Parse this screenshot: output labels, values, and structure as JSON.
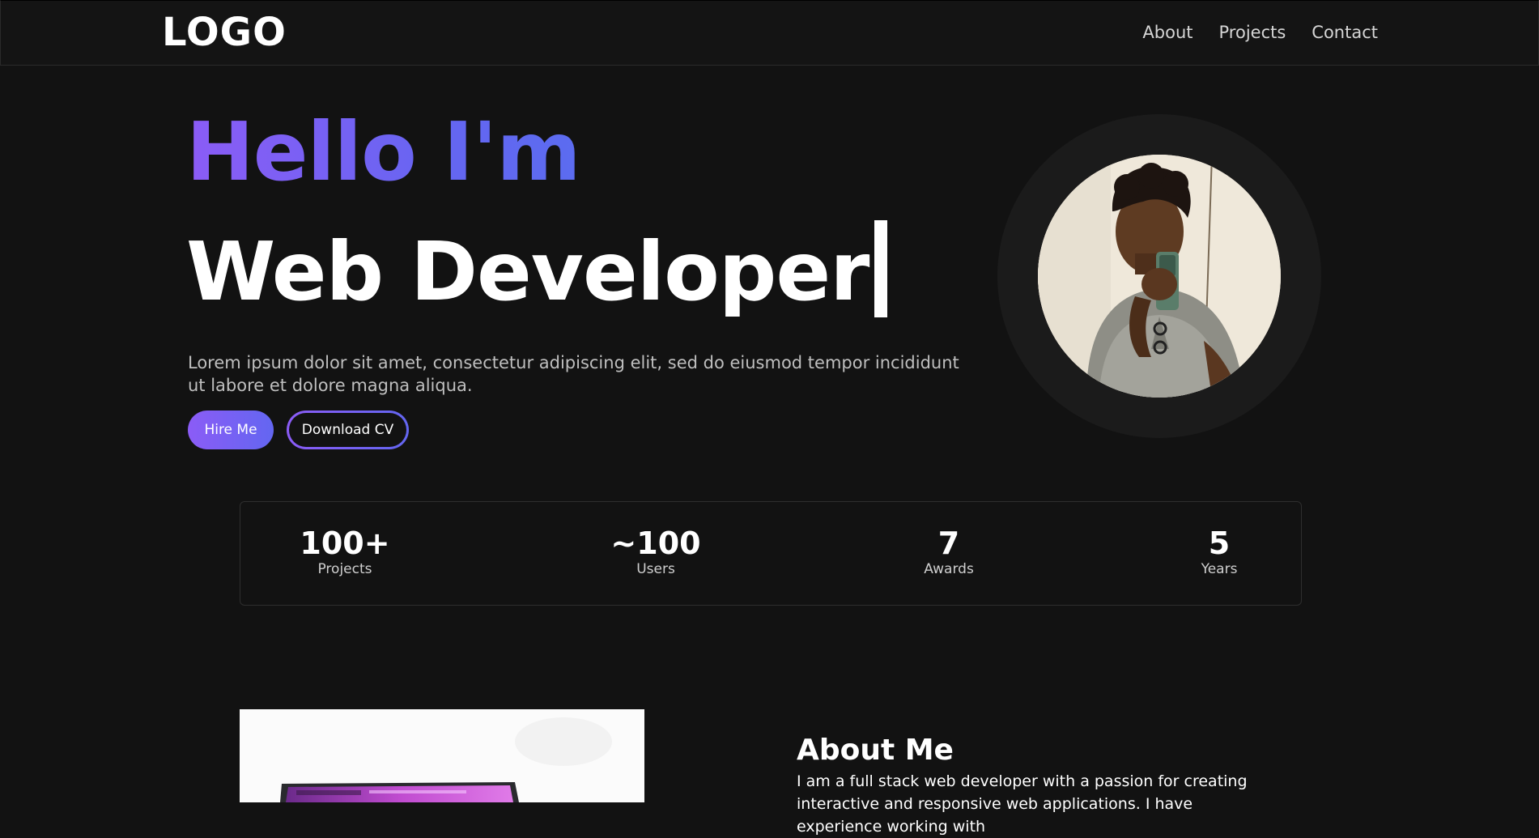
{
  "navbar": {
    "logo": "LOGO",
    "links": [
      "About",
      "Projects",
      "Contact"
    ]
  },
  "hero": {
    "greeting": "Hello I'm",
    "role": "Web Developer",
    "intro": "Lorem ipsum dolor sit amet, consectetur adipiscing elit, sed do eiusmod tempor incididunt ut labore et dolore magna aliqua.",
    "hire_label": "Hire Me",
    "cv_label": "Download CV"
  },
  "stats": [
    {
      "value": "100+",
      "label": "Projects"
    },
    {
      "value": "~100",
      "label": "Users"
    },
    {
      "value": "7",
      "label": "Awards"
    },
    {
      "value": "5",
      "label": "Years"
    }
  ],
  "about": {
    "title": "About Me",
    "text": "I am a full stack web developer with a passion for creating interactive and responsive web applications. I have experience working with"
  },
  "colors": {
    "background": "#121212",
    "accent_start": "#8b5cf6",
    "accent_end": "#6366f1"
  }
}
